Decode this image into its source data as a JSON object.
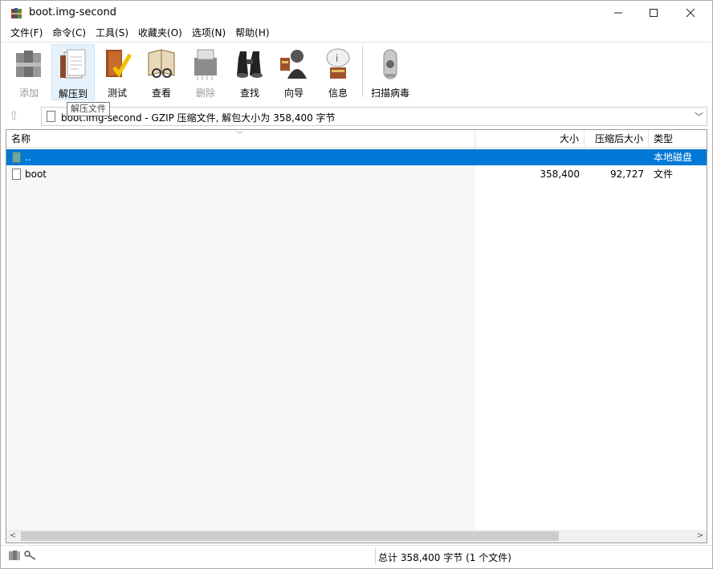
{
  "window": {
    "title": "boot.img-second"
  },
  "menu": [
    "文件(F)",
    "命令(C)",
    "工具(S)",
    "收藏夹(O)",
    "选项(N)",
    "帮助(H)"
  ],
  "toolbar": [
    {
      "label": "添加",
      "icon": "add-books-icon",
      "disabled": true
    },
    {
      "label": "解压到",
      "icon": "extract-book-icon",
      "hover": true
    },
    {
      "label": "测试",
      "icon": "test-check-icon"
    },
    {
      "label": "查看",
      "icon": "view-glasses-icon"
    },
    {
      "label": "删除",
      "icon": "delete-shredder-icon",
      "disabled": true
    },
    {
      "label": "查找",
      "icon": "find-binoculars-icon"
    },
    {
      "label": "向导",
      "icon": "wizard-icon"
    },
    {
      "label": "信息",
      "icon": "info-icon"
    },
    {
      "label": "扫描病毒",
      "icon": "virus-scan-icon"
    }
  ],
  "tooltip": "解压文件",
  "address": {
    "text": "boot.img-second - GZIP 压缩文件, 解包大小为 358,400 字节"
  },
  "columns": {
    "name": "名称",
    "size": "大小",
    "packed": "压缩后大小",
    "type": "类型"
  },
  "rows": [
    {
      "name": "..",
      "size": "",
      "packed": "",
      "type": "本地磁盘",
      "selected": true
    },
    {
      "name": "boot",
      "size": "358,400",
      "packed": "92,727",
      "type": "文件"
    }
  ],
  "status": {
    "text": "总计 358,400 字节 (1 个文件)"
  },
  "colors": {
    "selection": "#0078d7",
    "hover": "#e5f1fb"
  }
}
